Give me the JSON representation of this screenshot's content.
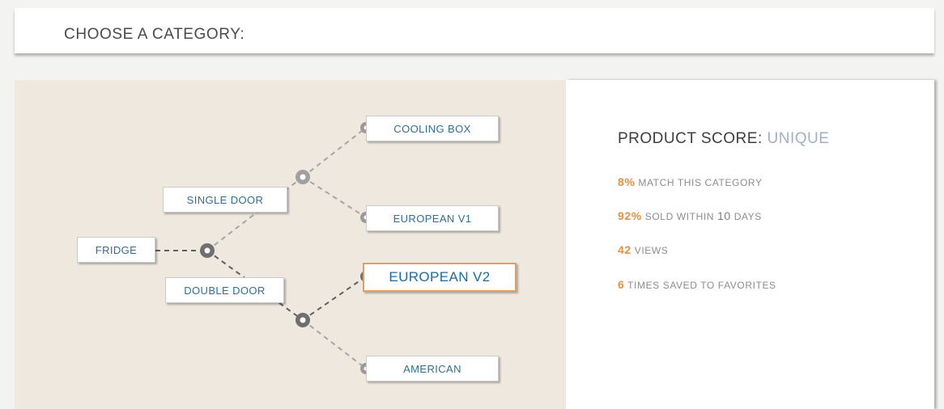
{
  "header": {
    "title": "CHOOSE A CATEGORY:"
  },
  "tree": {
    "root": "FRIDGE",
    "branches": {
      "single_door": "SINGLE DOOR",
      "double_door": "DOUBLE DOOR"
    },
    "leaves": {
      "cooling_box": "COOLING BOX",
      "european_v1": "EUROPEAN V1",
      "european_v2": "EUROPEAN V2",
      "american": "AMERICAN"
    },
    "selected": "EUROPEAN V2"
  },
  "score": {
    "label": "PRODUCT SCORE:",
    "value": "UNIQUE",
    "stats": [
      {
        "number": "8%",
        "text": "MATCH THIS CATEGORY"
      },
      {
        "number": "92%",
        "text_before": "SOLD WITHIN",
        "mid": "10",
        "text_after": "DAYS"
      },
      {
        "number": "42",
        "text": "VIEWS"
      },
      {
        "number": "6",
        "text": "TIMES SAVED TO FAVORITES"
      }
    ]
  },
  "colors": {
    "accent_orange": "#e58f43",
    "node_text_blue": "#2f6f98",
    "score_value_blue": "#9fb1c6",
    "tree_background": "#efe8df"
  }
}
